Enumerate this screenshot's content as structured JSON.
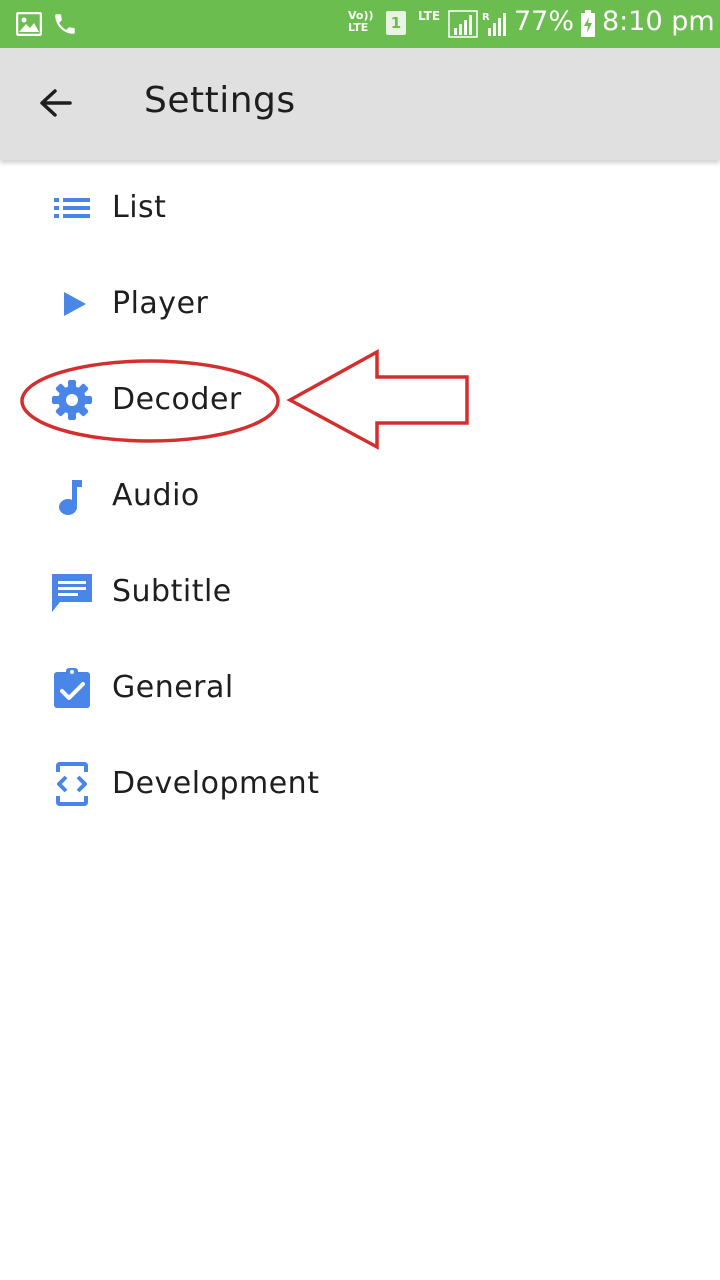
{
  "status_bar": {
    "volte": "Vo)) LTE",
    "sim": "1",
    "network": "LTE",
    "roaming": "R",
    "battery": "77%",
    "time": "8:10 pm",
    "color": "#6cbd4f"
  },
  "app_bar": {
    "title": "Settings",
    "background": "#e0e0e0"
  },
  "accent": "#4a86e8",
  "highlight_color": "#d32f2f",
  "settings": {
    "items": [
      {
        "label": "List",
        "icon": "list-icon"
      },
      {
        "label": "Player",
        "icon": "play-icon"
      },
      {
        "label": "Decoder",
        "icon": "gear-icon"
      },
      {
        "label": "Audio",
        "icon": "music-note-icon"
      },
      {
        "label": "Subtitle",
        "icon": "subtitle-icon"
      },
      {
        "label": "General",
        "icon": "clipboard-check-icon"
      },
      {
        "label": "Development",
        "icon": "developer-mode-icon"
      }
    ]
  }
}
